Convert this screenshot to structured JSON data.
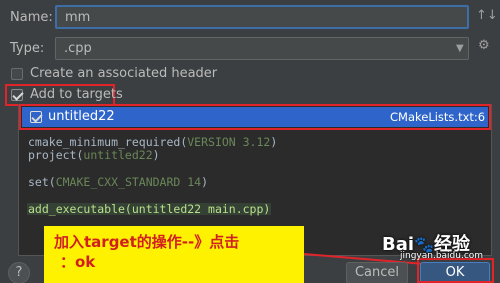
{
  "dialog": {
    "name_label": "Name:",
    "name_value": "mm",
    "type_label": "Type:",
    "type_value": ".cpp",
    "create_header_label": "Create an associated header",
    "add_targets_label": "Add to targets"
  },
  "targets": [
    {
      "name": "untitled22",
      "file": "CMakeLists.txt:6",
      "checked": true
    }
  ],
  "code_lines": {
    "l1a": "cmake_minimum_required(",
    "l1b": "VERSION 3.12",
    "l1c": ")",
    "l2a": "project(",
    "l2b": "untitled22",
    "l2c": ")",
    "l3a": "set(",
    "l3b": "CMAKE_CXX_STANDARD 14",
    "l3c": ")",
    "l4a": "add_executable(",
    "l4b": "untitled22 main.cpp",
    "l4c": ")"
  },
  "annotation": {
    "line1": "加入target的操作--》点击",
    "line2": "：ok"
  },
  "buttons": {
    "help": "?",
    "cancel": "Cancel",
    "ok": "OK"
  },
  "watermark": {
    "brand": "Bai",
    "brand2": "经验",
    "url": "jingyan.baidu.com"
  },
  "colors": {
    "background": "#3c3f41",
    "selection": "#2f65ca",
    "highlight_red": "#e0242a",
    "annotation_bg": "#fff200"
  }
}
